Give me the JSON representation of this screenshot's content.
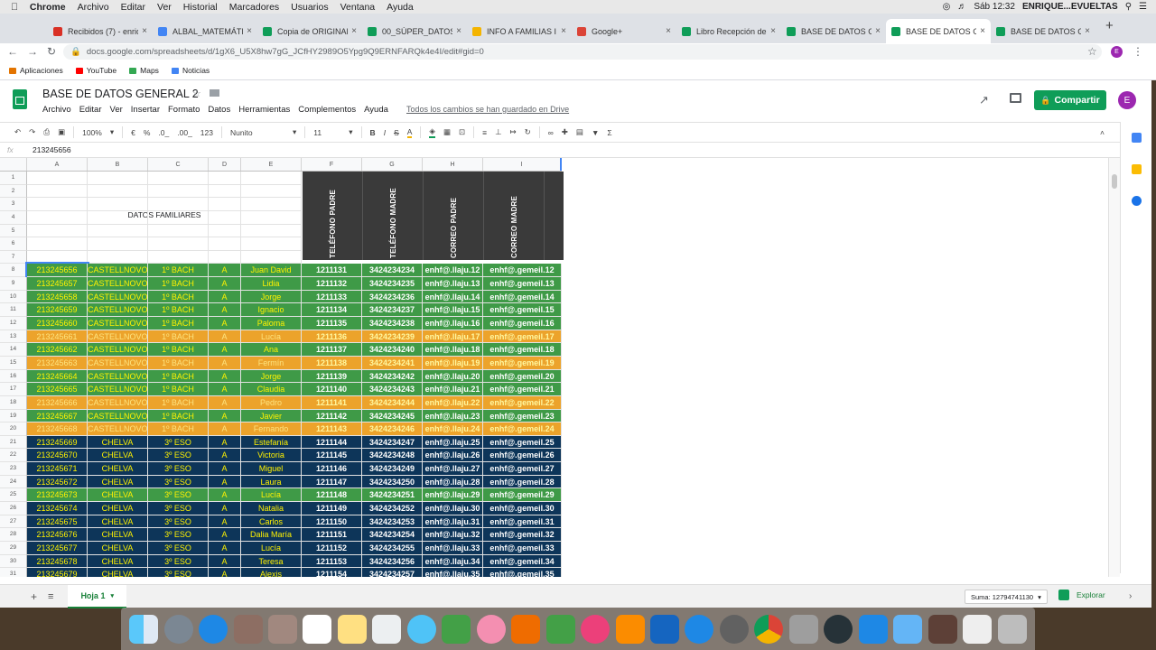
{
  "macos": {
    "app": "Chrome",
    "menus": [
      "Archivo",
      "Editar",
      "Ver",
      "Historial",
      "Marcadores",
      "Usuarios",
      "Ventana",
      "Ayuda"
    ],
    "clock": "Sáb 12:32",
    "user": "ENRIQUE...EVUELTAS"
  },
  "browser": {
    "tabs": [
      {
        "title": "Recibidos (7) - enriq",
        "color": "#d93025"
      },
      {
        "title": "ALBAL_MATEMÁTIC",
        "color": "#4285f4"
      },
      {
        "title": "Copia de ORIGINAL",
        "color": "#0f9d58"
      },
      {
        "title": "00_SÚPER_DATOS",
        "color": "#0f9d58"
      },
      {
        "title": "INFO A FAMILIAS I",
        "color": "#f4b400"
      },
      {
        "title": "Google+",
        "color": "#db4437"
      },
      {
        "title": "Libro Recepción de",
        "color": "#0f9d58"
      },
      {
        "title": "BASE DE DATOS G",
        "color": "#0f9d58"
      },
      {
        "title": "BASE DE DATOS G",
        "color": "#0f9d58"
      },
      {
        "title": "BASE DE DATOS G",
        "color": "#0f9d58"
      }
    ],
    "url": "docs.google.com/spreadsheets/d/1gX6_U5X8hw7gG_JCfHY2989O5Ypg9Q9ERNFARQk4e4I/edit#gid=0",
    "bookmarks": [
      {
        "label": "Aplicaciones",
        "color": "#e37400"
      },
      {
        "label": "YouTube",
        "color": "#ff0000"
      },
      {
        "label": "Maps",
        "color": "#34a853"
      },
      {
        "label": "Noticias",
        "color": "#4285f4"
      }
    ]
  },
  "doc": {
    "title": "BASE DE DATOS GENERAL 2",
    "menus": [
      "Archivo",
      "Editar",
      "Ver",
      "Insertar",
      "Formato",
      "Datos",
      "Herramientas",
      "Complementos",
      "Ayuda"
    ],
    "save_status": "Todos los cambios se han guardado en Drive",
    "share": "Compartir",
    "avatar": "E"
  },
  "format_toolbar": {
    "zoom": "100%",
    "currency": "€",
    "percent": "%",
    "dec0": ".0_",
    "dec00": ".00_",
    "numfmt": "123",
    "font": "Nunito",
    "size": "11"
  },
  "formula_bar": {
    "fx": "fx",
    "value": "213245656"
  },
  "columns": [
    {
      "letter": "A"
    },
    {
      "letter": "B"
    },
    {
      "letter": "C"
    },
    {
      "letter": "D"
    },
    {
      "letter": "E"
    },
    {
      "letter": "F"
    },
    {
      "letter": "G"
    },
    {
      "letter": "H"
    },
    {
      "letter": "I"
    }
  ],
  "header_block": {
    "family_label": "DATOS FAMILIARES",
    "headers": [
      "TELÉFONO PADRE",
      "TELÉFONO MADRE",
      "CORREO PADRE",
      "CORREO MADRE"
    ]
  },
  "row_styles": {
    "green": {
      "bg": "#3f9a47",
      "fg": "#fff200"
    },
    "orange": {
      "bg": "#eca32b",
      "fg": "#fff8a0"
    },
    "navy": {
      "bg": "#0d3559",
      "fg": "#fff200"
    }
  },
  "data_rows": [
    {
      "n": 8,
      "s": "green",
      "v": [
        "213245656",
        "CASTELLNOVO",
        "1º BACH",
        "A",
        "Juan David",
        "1211131",
        "3424234234",
        "enhf@.llaju.12",
        "enhf@.gemeil.12"
      ]
    },
    {
      "n": 9,
      "s": "green",
      "v": [
        "213245657",
        "CASTELLNOVO",
        "1º BACH",
        "A",
        "Lidia",
        "1211132",
        "3424234235",
        "enhf@.llaju.13",
        "enhf@.gemeil.13"
      ]
    },
    {
      "n": 10,
      "s": "green",
      "v": [
        "213245658",
        "CASTELLNOVO",
        "1º BACH",
        "A",
        "Jorge",
        "1211133",
        "3424234236",
        "enhf@.llaju.14",
        "enhf@.gemeil.14"
      ]
    },
    {
      "n": 11,
      "s": "green",
      "v": [
        "213245659",
        "CASTELLNOVO",
        "1º BACH",
        "A",
        "Ignacio",
        "1211134",
        "3424234237",
        "enhf@.llaju.15",
        "enhf@.gemeil.15"
      ]
    },
    {
      "n": 12,
      "s": "green",
      "v": [
        "213245660",
        "CASTELLNOVO",
        "1º BACH",
        "A",
        "Paloma",
        "1211135",
        "3424234238",
        "enhf@.llaju.16",
        "enhf@.gemeil.16"
      ]
    },
    {
      "n": 13,
      "s": "orange",
      "v": [
        "213245661",
        "CASTELLNOVO",
        "1º BACH",
        "A",
        "Lucía",
        "1211136",
        "3424234239",
        "enhf@.llaju.17",
        "enhf@.gemeil.17"
      ]
    },
    {
      "n": 14,
      "s": "green",
      "v": [
        "213245662",
        "CASTELLNOVO",
        "1º BACH",
        "A",
        "Ana",
        "1211137",
        "3424234240",
        "enhf@.llaju.18",
        "enhf@.gemeil.18"
      ]
    },
    {
      "n": 15,
      "s": "orange",
      "v": [
        "213245663",
        "CASTELLNOVO",
        "1º BACH",
        "A",
        "Fermín",
        "1211138",
        "3424234241",
        "enhf@.llaju.19",
        "enhf@.gemeil.19"
      ]
    },
    {
      "n": 16,
      "s": "green",
      "v": [
        "213245664",
        "CASTELLNOVO",
        "1º BACH",
        "A",
        "Jorge",
        "1211139",
        "3424234242",
        "enhf@.llaju.20",
        "enhf@.gemeil.20"
      ]
    },
    {
      "n": 17,
      "s": "green",
      "v": [
        "213245665",
        "CASTELLNOVO",
        "1º BACH",
        "A",
        "Claudia",
        "1211140",
        "3424234243",
        "enhf@.llaju.21",
        "enhf@.gemeil.21"
      ]
    },
    {
      "n": 18,
      "s": "orange",
      "v": [
        "213245666",
        "CASTELLNOVO",
        "1º BACH",
        "A",
        "Pedro",
        "1211141",
        "3424234244",
        "enhf@.llaju.22",
        "enhf@.gemeil.22"
      ]
    },
    {
      "n": 19,
      "s": "green",
      "v": [
        "213245667",
        "CASTELLNOVO",
        "1º BACH",
        "A",
        "Javier",
        "1211142",
        "3424234245",
        "enhf@.llaju.23",
        "enhf@.gemeil.23"
      ]
    },
    {
      "n": 20,
      "s": "orange",
      "v": [
        "213245668",
        "CASTELLNOVO",
        "1º BACH",
        "A",
        "Fernando",
        "1211143",
        "3424234246",
        "enhf@.llaju.24",
        "enhf@.gemeil.24"
      ]
    },
    {
      "n": 21,
      "s": "navy",
      "v": [
        "213245669",
        "CHELVA",
        "3º ESO",
        "A",
        "Estefanía",
        "1211144",
        "3424234247",
        "enhf@.llaju.25",
        "enhf@.gemeil.25"
      ]
    },
    {
      "n": 22,
      "s": "navy",
      "v": [
        "213245670",
        "CHELVA",
        "3º ESO",
        "A",
        "Victoria",
        "1211145",
        "3424234248",
        "enhf@.llaju.26",
        "enhf@.gemeil.26"
      ]
    },
    {
      "n": 23,
      "s": "navy",
      "v": [
        "213245671",
        "CHELVA",
        "3º ESO",
        "A",
        "Miguel",
        "1211146",
        "3424234249",
        "enhf@.llaju.27",
        "enhf@.gemeil.27"
      ]
    },
    {
      "n": 24,
      "s": "navy",
      "v": [
        "213245672",
        "CHELVA",
        "3º ESO",
        "A",
        "Laura",
        "1211147",
        "3424234250",
        "enhf@.llaju.28",
        "enhf@.gemeil.28"
      ]
    },
    {
      "n": 25,
      "s": "green",
      "v": [
        "213245673",
        "CHELVA",
        "3º ESO",
        "A",
        "Lucía",
        "1211148",
        "3424234251",
        "enhf@.llaju.29",
        "enhf@.gemeil.29"
      ]
    },
    {
      "n": 26,
      "s": "navy",
      "v": [
        "213245674",
        "CHELVA",
        "3º ESO",
        "A",
        "Natalia",
        "1211149",
        "3424234252",
        "enhf@.llaju.30",
        "enhf@.gemeil.30"
      ]
    },
    {
      "n": 27,
      "s": "navy",
      "v": [
        "213245675",
        "CHELVA",
        "3º ESO",
        "A",
        "Carlos",
        "1211150",
        "3424234253",
        "enhf@.llaju.31",
        "enhf@.gemeil.31"
      ]
    },
    {
      "n": 28,
      "s": "navy",
      "v": [
        "213245676",
        "CHELVA",
        "3º ESO",
        "A",
        "Dalia María",
        "1211151",
        "3424234254",
        "enhf@.llaju.32",
        "enhf@.gemeil.32"
      ]
    },
    {
      "n": 29,
      "s": "navy",
      "v": [
        "213245677",
        "CHELVA",
        "3º ESO",
        "A",
        "Lucía",
        "1211152",
        "3424234255",
        "enhf@.llaju.33",
        "enhf@.gemeil.33"
      ]
    },
    {
      "n": 30,
      "s": "navy",
      "v": [
        "213245678",
        "CHELVA",
        "3º ESO",
        "A",
        "Teresa",
        "1211153",
        "3424234256",
        "enhf@.llaju.34",
        "enhf@.gemeil.34"
      ]
    },
    {
      "n": 31,
      "s": "navy",
      "v": [
        "213245679",
        "CHELVA",
        "3º ESO",
        "A",
        "Alexis",
        "1211154",
        "3424234257",
        "enhf@.llaju.35",
        "enhf@.gemeil.35"
      ]
    }
  ],
  "sheet": {
    "tab": "Hoja 1",
    "sum": "Suma: 12794741130",
    "explore": "Explorar"
  }
}
